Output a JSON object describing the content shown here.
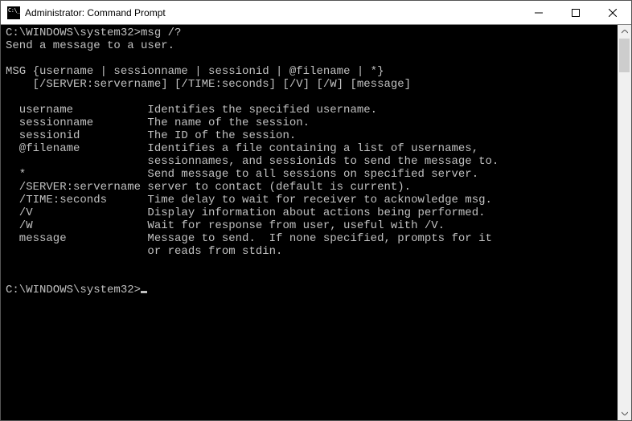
{
  "window": {
    "title": "Administrator: Command Prompt"
  },
  "prompt": {
    "path": "C:\\WINDOWS\\system32>",
    "command": "msg /?"
  },
  "help": {
    "summary": "Send a message to a user.",
    "usage1": "MSG {username | sessionname | sessionid | @filename | *}",
    "usage2": "    [/SERVER:servername] [/TIME:seconds] [/V] [/W] [message]",
    "options": [
      {
        "key": "username",
        "desc": "Identifies the specified username."
      },
      {
        "key": "sessionname",
        "desc": "The name of the session."
      },
      {
        "key": "sessionid",
        "desc": "The ID of the session."
      },
      {
        "key": "@filename",
        "desc": "Identifies a file containing a list of usernames,"
      },
      {
        "key": "",
        "desc": "sessionnames, and sessionids to send the message to."
      },
      {
        "key": "*",
        "desc": "Send message to all sessions on specified server."
      },
      {
        "key": "/SERVER:servername",
        "desc": "server to contact (default is current)."
      },
      {
        "key": "/TIME:seconds",
        "desc": "Time delay to wait for receiver to acknowledge msg."
      },
      {
        "key": "/V",
        "desc": "Display information about actions being performed."
      },
      {
        "key": "/W",
        "desc": "Wait for response from user, useful with /V."
      },
      {
        "key": "message",
        "desc": "Message to send.  If none specified, prompts for it"
      },
      {
        "key": "",
        "desc": "or reads from stdin."
      }
    ]
  },
  "prompt2": {
    "path": "C:\\WINDOWS\\system32>"
  }
}
